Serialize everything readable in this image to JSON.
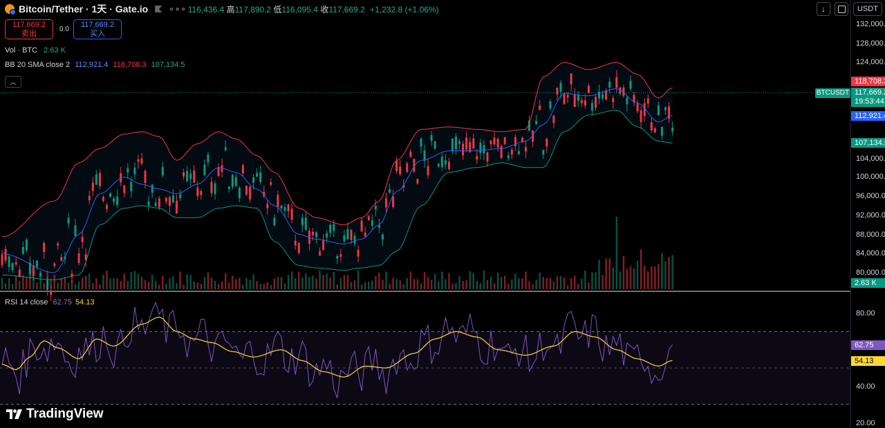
{
  "header": {
    "title": "Bitcoin/Tether · 1天 · Gate.io",
    "dots": "∘∘∘",
    "open_value": "116,436.4",
    "high_label": "高",
    "high_value": "117,890.2",
    "low_label": "低",
    "low_value": "116,095.4",
    "close_label": "收",
    "close_value": "117,669.2",
    "change": "+1,232.8 (+1.06%)",
    "currency": "USDT"
  },
  "trade": {
    "sell_price": "117,669.2",
    "sell_label": "卖出",
    "spread": "0.0",
    "buy_price": "117,669.2",
    "buy_label": "买入"
  },
  "legends": {
    "vol_name": "Vol · BTC",
    "vol_value": "2.63 K",
    "bb_name": "BB 20 SMA close 2",
    "bb_basis": "112,921.4",
    "bb_upper": "118,708.3",
    "bb_lower": "107,134.5",
    "rsi_name": "RSI 14 close",
    "rsi_value": "62.75",
    "rsi_ma": "54.13"
  },
  "price_axis": [
    "132,000.0",
    "128,000.0",
    "124,000.0",
    "100,000.0",
    "104,000.0",
    "96,000.0",
    "92,000.0",
    "88,000.0",
    "84,000.0",
    "80,000.0"
  ],
  "price_axis_values": [
    132000,
    128000,
    124000,
    100000,
    104000,
    96000,
    92000,
    88000,
    84000,
    80000
  ],
  "rsi_axis": [
    "80.00",
    "40.00",
    "20.00"
  ],
  "rsi_axis_values": [
    80,
    40,
    20
  ],
  "price_tags": {
    "upper": "118,708.3",
    "last": "117,669.2",
    "countdown": "19:53:44",
    "basis": "112,921.4",
    "lower": "107,134.5",
    "volume": "2.63 K",
    "rsi": "62.75",
    "rsi_ma": "54.13",
    "symbol": "BTCUSDT"
  },
  "logo": "TradingView",
  "colors": {
    "up": "#089981",
    "down": "#f23645",
    "bb_upper": "#f23645",
    "bb_basis": "#2962ff",
    "bb_lower": "#089981",
    "rsi": "#7e57c2",
    "rsi_ma": "#fdd835"
  },
  "chart_data": [
    {
      "type": "candlestick",
      "title": "Bitcoin/Tether · 1天 · Gate.io",
      "ylim": [
        78500,
        133500
      ],
      "bollinger_knots": [
        {
          "i": 0,
          "basis": 84000,
          "upper": 87500,
          "lower": 79500
        },
        {
          "i": 15,
          "basis": 80000,
          "upper": 95000,
          "lower": 78500
        },
        {
          "i": 22,
          "basis": 88000,
          "upper": 103000,
          "lower": 79500
        },
        {
          "i": 28,
          "basis": 96500,
          "upper": 106000,
          "lower": 90000
        },
        {
          "i": 35,
          "basis": 100000,
          "upper": 109000,
          "lower": 93500
        },
        {
          "i": 40,
          "basis": 98500,
          "upper": 109500,
          "lower": 94000
        },
        {
          "i": 45,
          "basis": 97500,
          "upper": 108500,
          "lower": 93500
        },
        {
          "i": 50,
          "basis": 96500,
          "upper": 103500,
          "lower": 91500
        },
        {
          "i": 56,
          "basis": 98500,
          "upper": 107000,
          "lower": 91500
        },
        {
          "i": 62,
          "basis": 102000,
          "upper": 109500,
          "lower": 93500
        },
        {
          "i": 67,
          "basis": 101000,
          "upper": 108000,
          "lower": 94000
        },
        {
          "i": 73,
          "basis": 97500,
          "upper": 104500,
          "lower": 93500
        },
        {
          "i": 78,
          "basis": 94000,
          "upper": 101000,
          "lower": 86500
        },
        {
          "i": 85,
          "basis": 88000,
          "upper": 93500,
          "lower": 81500
        },
        {
          "i": 90,
          "basis": 87000,
          "upper": 91500,
          "lower": 81000
        },
        {
          "i": 98,
          "basis": 86000,
          "upper": 90000,
          "lower": 80500
        },
        {
          "i": 103,
          "basis": 87000,
          "upper": 91500,
          "lower": 81000
        },
        {
          "i": 108,
          "basis": 90000,
          "upper": 95000,
          "lower": 81500
        },
        {
          "i": 113,
          "basis": 97000,
          "upper": 103500,
          "lower": 84500
        },
        {
          "i": 120,
          "basis": 103500,
          "upper": 110000,
          "lower": 94000
        },
        {
          "i": 128,
          "basis": 105500,
          "upper": 110500,
          "lower": 101000
        },
        {
          "i": 136,
          "basis": 105500,
          "upper": 110000,
          "lower": 102000
        },
        {
          "i": 143,
          "basis": 106000,
          "upper": 109500,
          "lower": 103000
        },
        {
          "i": 150,
          "basis": 107500,
          "upper": 110000,
          "lower": 102000
        },
        {
          "i": 155,
          "basis": 111000,
          "upper": 121000,
          "lower": 102000
        },
        {
          "i": 161,
          "basis": 117500,
          "upper": 124000,
          "lower": 109500
        },
        {
          "i": 168,
          "basis": 117000,
          "upper": 122500,
          "lower": 113000
        },
        {
          "i": 176,
          "basis": 118500,
          "upper": 124000,
          "lower": 114000
        },
        {
          "i": 182,
          "basis": 115500,
          "upper": 121500,
          "lower": 110500
        },
        {
          "i": 188,
          "basis": 111500,
          "upper": 116500,
          "lower": 107500
        },
        {
          "i": 192,
          "basis": 112921.4,
          "upper": 118708.3,
          "lower": 107134.5
        }
      ],
      "last_price": 117669.2
    },
    {
      "type": "line",
      "title": "RSI 14 close",
      "ylim": [
        15,
        90
      ],
      "bands": [
        30,
        70
      ],
      "series": [
        {
          "name": "RSI 14 close",
          "last": 62.75
        },
        {
          "name": "MA",
          "last": 54.13
        }
      ],
      "rsi_ma_knots": [
        [
          0,
          52
        ],
        [
          4,
          49
        ],
        [
          8,
          56
        ],
        [
          12,
          65
        ],
        [
          16,
          61
        ],
        [
          22,
          55
        ],
        [
          27,
          66
        ],
        [
          32,
          62
        ],
        [
          40,
          74
        ],
        [
          45,
          78
        ],
        [
          50,
          70
        ],
        [
          55,
          66
        ],
        [
          60,
          64
        ],
        [
          66,
          59
        ],
        [
          72,
          56
        ],
        [
          80,
          60
        ],
        [
          86,
          54
        ],
        [
          92,
          48
        ],
        [
          98,
          45
        ],
        [
          104,
          51
        ],
        [
          110,
          50
        ],
        [
          118,
          58
        ],
        [
          124,
          66
        ],
        [
          130,
          70
        ],
        [
          136,
          67
        ],
        [
          142,
          60
        ],
        [
          150,
          57
        ],
        [
          158,
          62
        ],
        [
          164,
          70
        ],
        [
          170,
          67
        ],
        [
          176,
          60
        ],
        [
          182,
          55
        ],
        [
          188,
          51
        ],
        [
          192,
          54.13
        ]
      ],
      "rsi_last": 62.75
    }
  ]
}
